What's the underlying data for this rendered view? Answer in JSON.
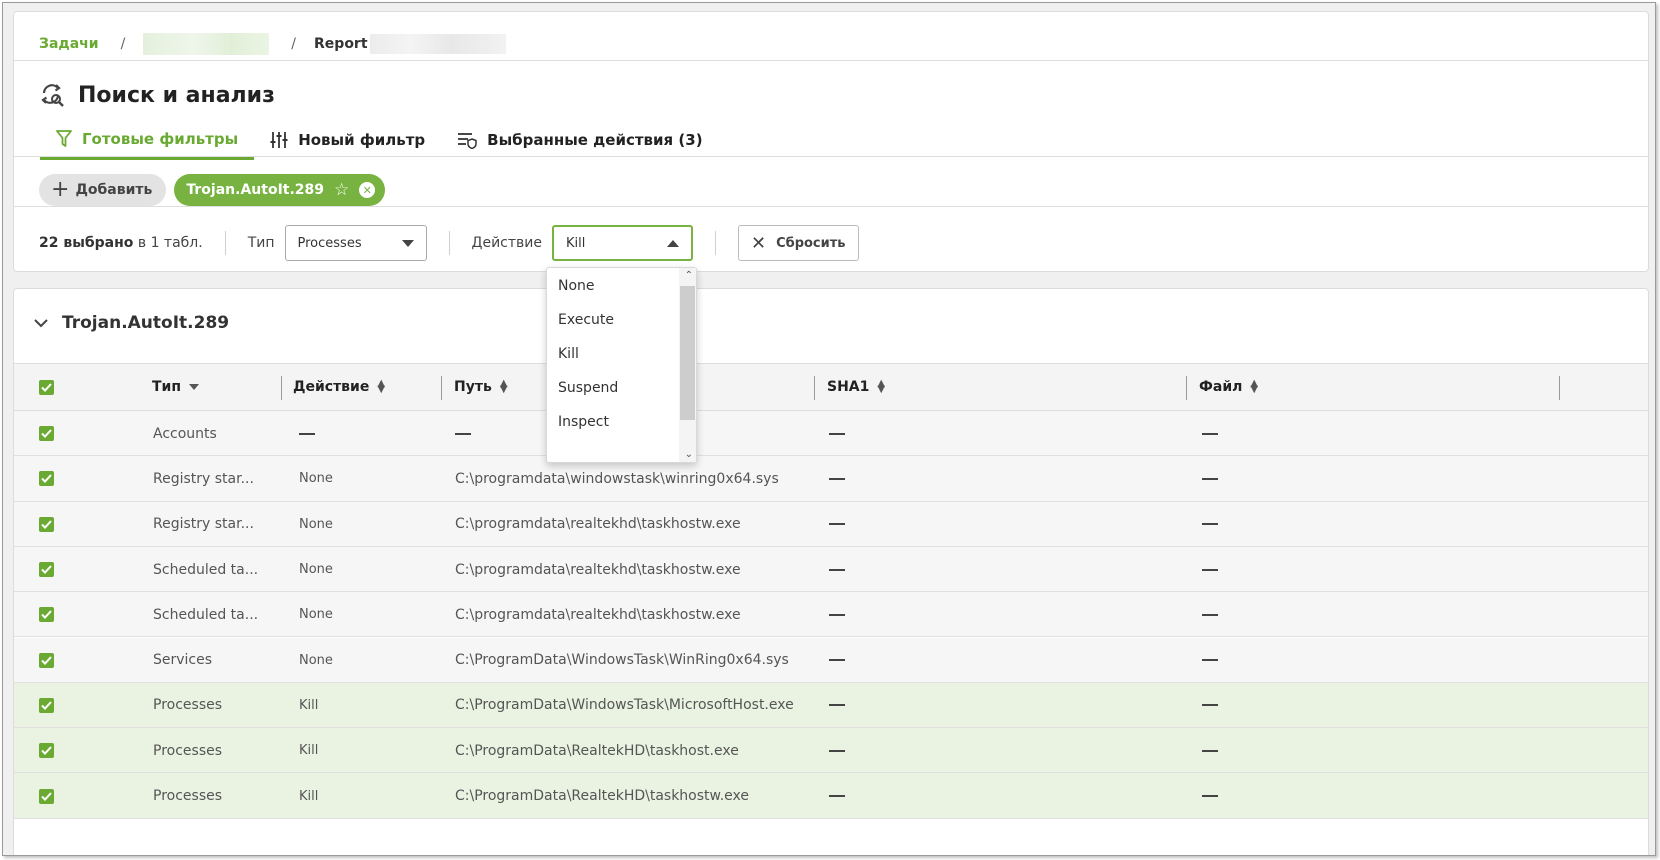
{
  "breadcrumb": {
    "root": "Задачи",
    "report_label": "Report"
  },
  "header": {
    "title": "Поиск и анализ"
  },
  "tabs": [
    {
      "label": "Готовые фильтры"
    },
    {
      "label": "Новый фильтр"
    },
    {
      "label": "Выбранные действия (3)"
    }
  ],
  "chips": {
    "add_label": "Добавить",
    "filter_label": "Trojan.AutoIt.289"
  },
  "toolbar": {
    "selected_count": "22 выбрано",
    "selected_suffix": "в 1 табл.",
    "type_label": "Тип",
    "type_value": "Processes",
    "action_label": "Действие",
    "action_value": "Kill",
    "reset_label": "Сбросить"
  },
  "dropdown": {
    "options": [
      "None",
      "Execute",
      "Kill",
      "Suspend",
      "Inspect"
    ]
  },
  "group": {
    "title": "Trojan.AutoIt.289"
  },
  "table": {
    "columns": [
      "Тип",
      "Действие",
      "Путь",
      "SHA1",
      "Файл"
    ],
    "rows": [
      {
        "type": "Accounts",
        "action": "—",
        "path": "—",
        "sha1": "—",
        "file": "—"
      },
      {
        "type": "Registry star...",
        "action": "None",
        "path": "C:\\programdata\\windowstask\\winring0x64.sys",
        "sha1": "—",
        "file": "—"
      },
      {
        "type": "Registry star...",
        "action": "None",
        "path": "C:\\programdata\\realtekhd\\taskhostw.exe",
        "sha1": "—",
        "file": "—"
      },
      {
        "type": "Scheduled ta...",
        "action": "None",
        "path": "C:\\programdata\\realtekhd\\taskhostw.exe",
        "sha1": "—",
        "file": "—"
      },
      {
        "type": "Scheduled ta...",
        "action": "None",
        "path": "C:\\programdata\\realtekhd\\taskhostw.exe",
        "sha1": "—",
        "file": "—"
      },
      {
        "type": "Services",
        "action": "None",
        "path": "C:\\ProgramData\\WindowsTask\\WinRing0x64.sys",
        "sha1": "—",
        "file": "—"
      },
      {
        "type": "Processes",
        "action": "Kill",
        "path": "C:\\ProgramData\\WindowsTask\\MicrosoftHost.exe",
        "sha1": "—",
        "file": "—"
      },
      {
        "type": "Processes",
        "action": "Kill",
        "path": "C:\\ProgramData\\RealtekHD\\taskhost.exe",
        "sha1": "—",
        "file": "—"
      },
      {
        "type": "Processes",
        "action": "Kill",
        "path": "C:\\ProgramData\\RealtekHD\\taskhostw.exe",
        "sha1": "—",
        "file": "—"
      }
    ]
  },
  "colors": {
    "accent": "#78b342",
    "accent_text": "#6aaa32",
    "highlight_row": "#eaf3e2"
  }
}
